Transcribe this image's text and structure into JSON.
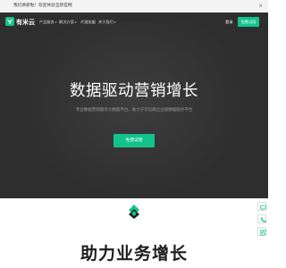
{
  "announcement": {
    "text": "我们焕新啦！欢迎体验全新官网",
    "close_icon": "close-icon"
  },
  "nav": {
    "logo_text": "有米云",
    "items": [
      {
        "label": "产品服务",
        "has_dropdown": true
      },
      {
        "label": "解决方案",
        "has_dropdown": true
      },
      {
        "label": "代理加盟",
        "has_dropdown": false
      },
      {
        "label": "关于我们",
        "has_dropdown": true
      }
    ],
    "login_label": "登录",
    "signup_label": "免费试用"
  },
  "hero": {
    "title": "数据驱动营销增长",
    "subtitle": "专业数据营销服务大数据平台，助力于可信赖企业级数据服务平台",
    "cta_label": "免费试用"
  },
  "section": {
    "title": "助力业务增长"
  },
  "colors": {
    "accent": "#13c48a",
    "hero_bg": "#2e2e2e",
    "announce_bg": "#f3f3f3"
  }
}
